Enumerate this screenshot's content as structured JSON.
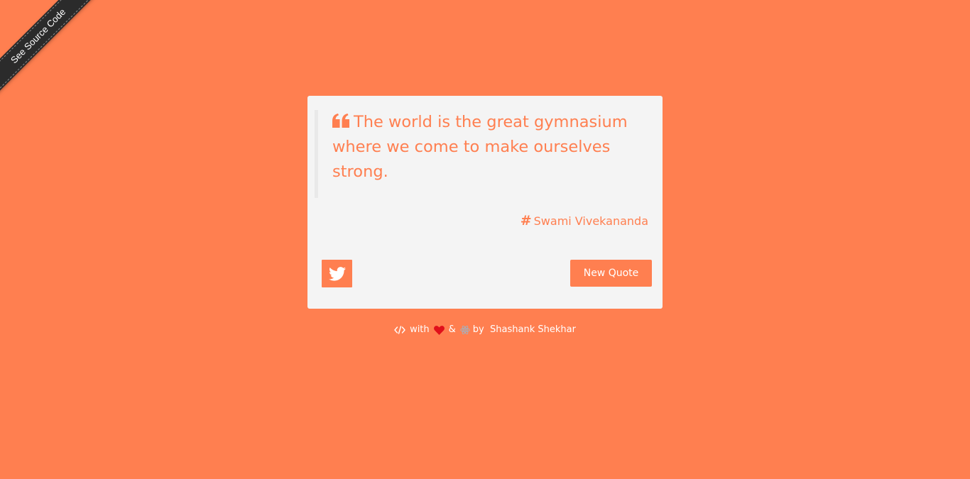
{
  "ribbon": {
    "label": "See Source Code"
  },
  "quote": {
    "text": "The world is the great gymnasium where we come to make ourselves strong.",
    "author": "Swami Vivekananda",
    "quote_icon": "quote-left-icon",
    "author_icon": "hashtag-icon"
  },
  "actions": {
    "tweet_icon": "twitter-icon",
    "new_quote_label": "New Quote"
  },
  "footer": {
    "with_label": "with",
    "and_label": "&",
    "by_label": "by",
    "name": "Shashank Shekhar",
    "icons": [
      "code-icon",
      "heart-icon",
      "react-icon"
    ]
  },
  "colors": {
    "background": "#ff7f50",
    "card": "#f4f4f4",
    "accent": "#ff7f50",
    "heart": "#e0101b",
    "ribbon": "#2b2b2b"
  }
}
